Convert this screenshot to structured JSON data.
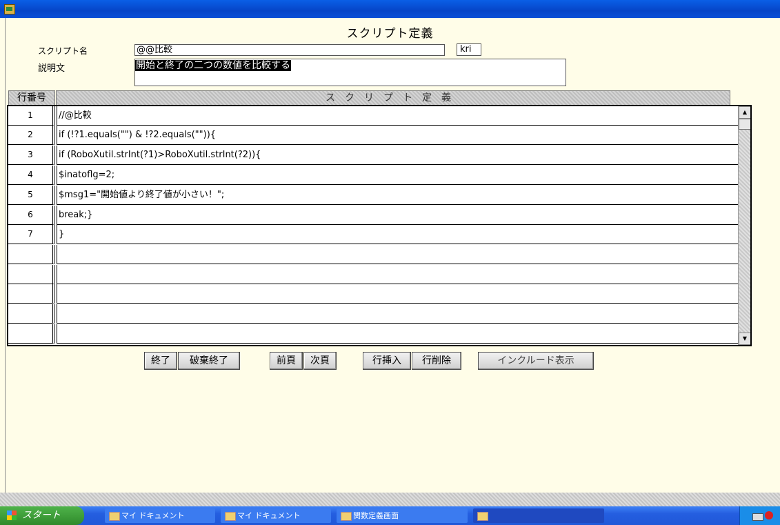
{
  "header": {
    "title": "スクリプト定義"
  },
  "form": {
    "name_label": "スクリプト名",
    "name_value": "@@比較",
    "ext_value": "kri",
    "desc_label": "説明文",
    "desc_value": "開始と終了の二つの数値を比較する"
  },
  "grid": {
    "col_num": "行番号",
    "col_def": "スクリプト定義",
    "rows": [
      {
        "num": "1",
        "code": "//@比較"
      },
      {
        "num": "2",
        "code": "if (!?1.equals(\"\") & !?2.equals(\"\")){"
      },
      {
        "num": "3",
        "code": "if (RoboXutil.strInt(?1)>RoboXutil.strInt(?2)){"
      },
      {
        "num": "4",
        "code": "$inatoflg=2;"
      },
      {
        "num": "5",
        "code": "$msg1=\"開始値より終了値が小さい！\";"
      },
      {
        "num": "6",
        "code": "break;}"
      },
      {
        "num": "7",
        "code": "}"
      },
      {
        "num": "",
        "code": ""
      },
      {
        "num": "",
        "code": ""
      },
      {
        "num": "",
        "code": ""
      },
      {
        "num": "",
        "code": ""
      },
      {
        "num": "",
        "code": ""
      }
    ]
  },
  "buttons": {
    "end": "終了",
    "discard": "破棄終了",
    "prev": "前頁",
    "next": "次頁",
    "insert": "行挿入",
    "delete": "行削除",
    "include": "インクルード表示"
  },
  "taskbar": {
    "start": "スタート",
    "tasks": [
      "マイ ドキュメント",
      "マイ ドキュメント",
      "関数定義画面",
      ""
    ]
  }
}
